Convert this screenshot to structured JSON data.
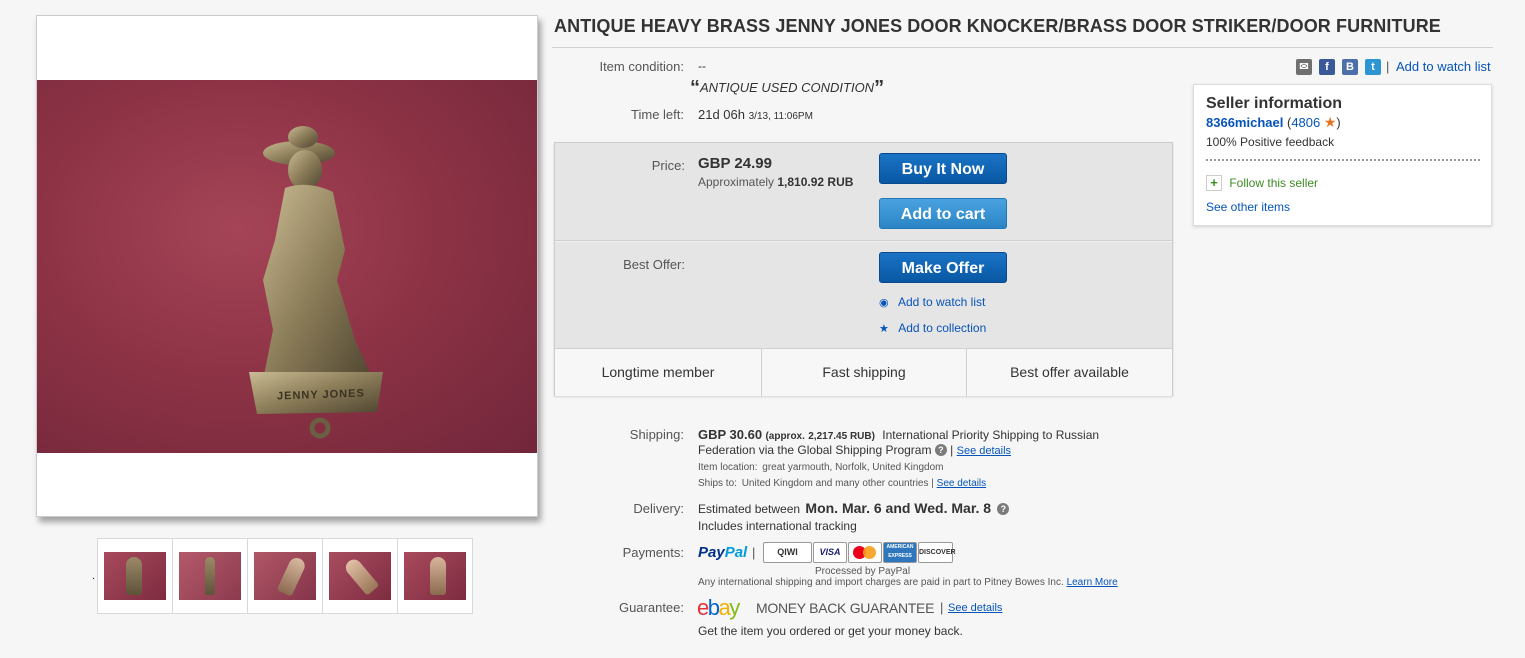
{
  "title": "ANTIQUE HEAVY BRASS JENNY JONES DOOR KNOCKER/BRASS DOOR STRIKER/DOOR FURNITURE",
  "gallery": {
    "thumbnail_count": 5,
    "photo_caption": "JENNY JONES",
    "pager_dot": "."
  },
  "share": {
    "watch_label": "Add to watch list",
    "separator": "|",
    "icons": [
      "email-icon",
      "facebook-icon",
      "blogger-icon",
      "twitter-icon"
    ]
  },
  "condition": {
    "label": "Item condition:",
    "value": "--",
    "quote_open": "“",
    "note": "ANTIQUE USED CONDITION",
    "quote_close": "”"
  },
  "time_left": {
    "label": "Time left:",
    "value": "21d 06h",
    "end": "3/13, 11:06PM"
  },
  "price": {
    "label": "Price:",
    "amount": "GBP 24.99",
    "approx_label": "Approximately",
    "approx_value": "1,810.92 RUB"
  },
  "buttons": {
    "buy_now": "Buy It Now",
    "add_to_cart": "Add to cart",
    "make_offer": "Make Offer"
  },
  "best_offer": {
    "label": "Best Offer:",
    "watch": "Add to watch list",
    "collection": "Add to collection"
  },
  "badges": [
    "Longtime member",
    "Fast shipping",
    "Best offer available"
  ],
  "seller": {
    "heading": "Seller information",
    "name": "8366michael",
    "open_paren": "(",
    "score": "4806",
    "close_paren": ")",
    "feedback": "100% Positive feedback",
    "follow": "Follow this seller",
    "other_items": "See other items",
    "star_color": "#e8731f"
  },
  "shipping": {
    "label": "Shipping:",
    "cost": "GBP 30.60",
    "approx": "(approx.",
    "approx_value": "2,217.45 RUB)",
    "method": "International Priority Shipping to Russian",
    "method2": "Federation  via the Global Shipping Program",
    "sep": "|",
    "see_details": "See details",
    "location_label": "Item location:",
    "location": "great yarmouth, Norfolk, United Kingdom",
    "ships_to_label": "Ships to:",
    "ships_to": "United Kingdom and many other countries",
    "ships_sep": "|",
    "ships_details": "See details"
  },
  "delivery": {
    "label": "Delivery:",
    "prefix": "Estimated between",
    "dates": "Mon. Mar. 6 and Wed. Mar. 8",
    "tracking": "Includes international tracking"
  },
  "payments": {
    "label": "Payments:",
    "paypal_pay": "Pay",
    "paypal_pal": "Pal",
    "sep": "|",
    "cards": [
      "QIWI",
      "VISA",
      "MC",
      "AMERICAN EXPRESS",
      "DISCOVER"
    ],
    "processed": "Processed by PayPal",
    "note": "Any international shipping and import charges are paid in part to Pitney Bowes Inc.",
    "learn_more": "Learn More"
  },
  "guarantee": {
    "label": "Guarantee:",
    "logo": [
      "e",
      "b",
      "a",
      "y"
    ],
    "text": "MONEY BACK GUARANTEE",
    "sep": "|",
    "see_details": "See details",
    "sub": "Get the item you ordered or get your money back."
  },
  "colors": {
    "link": "#0654ba",
    "button_dark": "#0a5fae",
    "button_light": "#3a93d4",
    "follow_green": "#3d8c26",
    "ebay": [
      "#e53238",
      "#0064d2",
      "#f5af02",
      "#86b817"
    ]
  }
}
